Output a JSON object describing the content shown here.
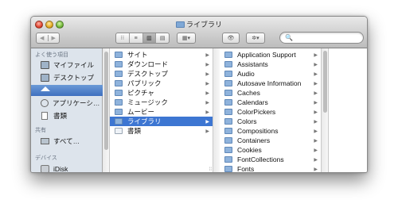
{
  "window": {
    "title": "ライブラリ"
  },
  "toolbar": {
    "nav_back": "◀",
    "nav_forward": "▶",
    "view_icons": "⁝⁝",
    "view_list": "≡",
    "view_columns": "▥",
    "view_coverflow": "▤",
    "arrange": "▦▾",
    "quicklook": "👁",
    "action": "✲▾",
    "search_icon": "🔍",
    "search_placeholder": ""
  },
  "sidebar": {
    "favorites_header": "よく使う項目",
    "items": [
      {
        "label": "マイファイル",
        "icon": "monitor-icon"
      },
      {
        "label": "デスクトップ",
        "icon": "monitor-icon"
      },
      {
        "label": "",
        "icon": "home-icon",
        "selected": true
      },
      {
        "label": "アプリケーシ…",
        "icon": "apps-icon"
      },
      {
        "label": "書類",
        "icon": "document-icon"
      }
    ],
    "shared_header": "共有",
    "shared_items": [
      {
        "label": "すべて…",
        "icon": "network-icon"
      }
    ],
    "devices_header": "デバイス",
    "device_items": [
      {
        "label": "iDisk",
        "icon": "disk-icon"
      }
    ]
  },
  "column1": {
    "items": [
      {
        "label": "サイト",
        "arrow": "▶"
      },
      {
        "label": "ダウンロード",
        "arrow": "▶"
      },
      {
        "label": "デスクトップ",
        "arrow": "▶"
      },
      {
        "label": "パブリック",
        "arrow": "▶"
      },
      {
        "label": "ピクチャ",
        "arrow": "▶"
      },
      {
        "label": "ミュージック",
        "arrow": "▶"
      },
      {
        "label": "ムービー",
        "arrow": "▶"
      },
      {
        "label": "ライブラリ",
        "arrow": "▶",
        "selected": true
      },
      {
        "label": "書類",
        "arrow": "▶"
      }
    ]
  },
  "column2": {
    "items": [
      {
        "label": "Application Support",
        "arrow": "▶"
      },
      {
        "label": "Assistants",
        "arrow": "▶"
      },
      {
        "label": "Audio",
        "arrow": "▶"
      },
      {
        "label": "Autosave Information",
        "arrow": "▶"
      },
      {
        "label": "Caches",
        "arrow": "▶"
      },
      {
        "label": "Calendars",
        "arrow": "▶"
      },
      {
        "label": "ColorPickers",
        "arrow": "▶"
      },
      {
        "label": "Colors",
        "arrow": "▶"
      },
      {
        "label": "Compositions",
        "arrow": "▶"
      },
      {
        "label": "Containers",
        "arrow": "▶"
      },
      {
        "label": "Cookies",
        "arrow": "▶"
      },
      {
        "label": "FontCollections",
        "arrow": "▶"
      },
      {
        "label": "Fonts",
        "arrow": "▶"
      }
    ]
  },
  "column_grip": "⁞⁞"
}
